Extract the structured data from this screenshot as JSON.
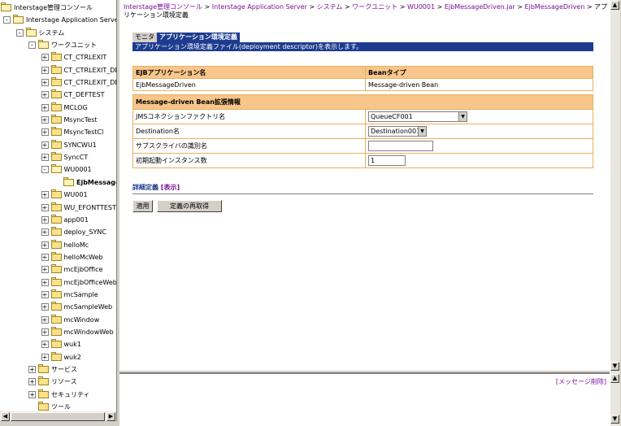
{
  "tree": [
    {
      "label": "Interstage管理コンソール",
      "level": 0,
      "expander": "",
      "open": true
    },
    {
      "label": "Interstage Application Server",
      "level": 0,
      "expander": "-",
      "open": true
    },
    {
      "label": "システム",
      "level": 1,
      "expander": "-",
      "open": true
    },
    {
      "label": "ワークユニット",
      "level": 2,
      "expander": "-",
      "open": true
    },
    {
      "label": "CT_CTRLEXIT",
      "level": 3,
      "expander": "+",
      "open": false
    },
    {
      "label": "CT_CTRLEXIT_DB",
      "level": 3,
      "expander": "+",
      "open": false
    },
    {
      "label": "CT_CTRLEXIT_DB",
      "level": 3,
      "expander": "+",
      "open": false
    },
    {
      "label": "CT_DEFTEST",
      "level": 3,
      "expander": "+",
      "open": false
    },
    {
      "label": "MCLOG",
      "level": 3,
      "expander": "+",
      "open": false
    },
    {
      "label": "MsyncTest",
      "level": 3,
      "expander": "+",
      "open": false
    },
    {
      "label": "MsyncTestCl",
      "level": 3,
      "expander": "+",
      "open": false
    },
    {
      "label": "SYNCWU1",
      "level": 3,
      "expander": "+",
      "open": false
    },
    {
      "label": "SyncCT",
      "level": 3,
      "expander": "+",
      "open": false
    },
    {
      "label": "WU0001",
      "level": 3,
      "expander": "-",
      "open": true
    },
    {
      "label": "EjbMessage",
      "level": 4,
      "expander": "",
      "open": true,
      "selected": true
    },
    {
      "label": "WU001",
      "level": 3,
      "expander": "+",
      "open": false
    },
    {
      "label": "WU_EFONTTEST",
      "level": 3,
      "expander": "+",
      "open": false
    },
    {
      "label": "app001",
      "level": 3,
      "expander": "+",
      "open": false
    },
    {
      "label": "deploy_SYNC",
      "level": 3,
      "expander": "+",
      "open": false
    },
    {
      "label": "helloMc",
      "level": 3,
      "expander": "+",
      "open": false
    },
    {
      "label": "helloMcWeb",
      "level": 3,
      "expander": "+",
      "open": false
    },
    {
      "label": "mcEjbOffice",
      "level": 3,
      "expander": "+",
      "open": false
    },
    {
      "label": "mcEjbOfficeWeb",
      "level": 3,
      "expander": "+",
      "open": false
    },
    {
      "label": "mcSample",
      "level": 3,
      "expander": "+",
      "open": false
    },
    {
      "label": "mcSampleWeb",
      "level": 3,
      "expander": "+",
      "open": false
    },
    {
      "label": "mcWindow",
      "level": 3,
      "expander": "+",
      "open": false
    },
    {
      "label": "mcWindowWeb",
      "level": 3,
      "expander": "+",
      "open": false
    },
    {
      "label": "wuk1",
      "level": 3,
      "expander": "+",
      "open": false
    },
    {
      "label": "wuk2",
      "level": 3,
      "expander": "+",
      "open": false
    },
    {
      "label": "サービス",
      "level": 2,
      "expander": "+",
      "open": false
    },
    {
      "label": "リソース",
      "level": 2,
      "expander": "+",
      "open": false
    },
    {
      "label": "セキュリティ",
      "level": 2,
      "expander": "+",
      "open": false
    },
    {
      "label": "ツール",
      "level": 2,
      "expander": "",
      "open": false
    }
  ],
  "breadcrumb": {
    "items": [
      "Interstage管理コンソール",
      "Interstage Application Server",
      "システム",
      "ワークユニット",
      "WU0001",
      "EjbMessageDriven.jar",
      "EjbMessageDriven"
    ],
    "current": "アプリケーション環境定義",
    "separator": ">"
  },
  "tabs": {
    "monitor": "モニタ",
    "app_def": "アプリケーション環境定義"
  },
  "tab_description": "アプリケーション環境定義ファイル(deployment descriptor)を表示します。",
  "ejb_table": {
    "headers": [
      "EJBアプリケーション名",
      "Beanタイプ"
    ],
    "row": [
      "EjbMessageDriven",
      "Message-driven Bean"
    ]
  },
  "props": {
    "section_title": "Message-driven Bean拡張情報",
    "jms_label": "JMSコネクションファクトリ名",
    "jms_value": "QueueCF001",
    "dest_label": "Destination名",
    "dest_value": "Destination001",
    "subscriber_label": "サブスクライバの識別名",
    "subscriber_value": "",
    "instances_label": "初期起動インスタンス数",
    "instances_value": "1"
  },
  "detail": {
    "label": "詳細定義",
    "show": "[表示]"
  },
  "buttons": {
    "apply": "適用",
    "reload": "定義の再取得"
  },
  "messages": {
    "clear": "[メッセージ削除]"
  },
  "colors": {
    "accent": "#1d3c8f",
    "link": "#7a0e9a",
    "table_header": "#f8c68a"
  }
}
